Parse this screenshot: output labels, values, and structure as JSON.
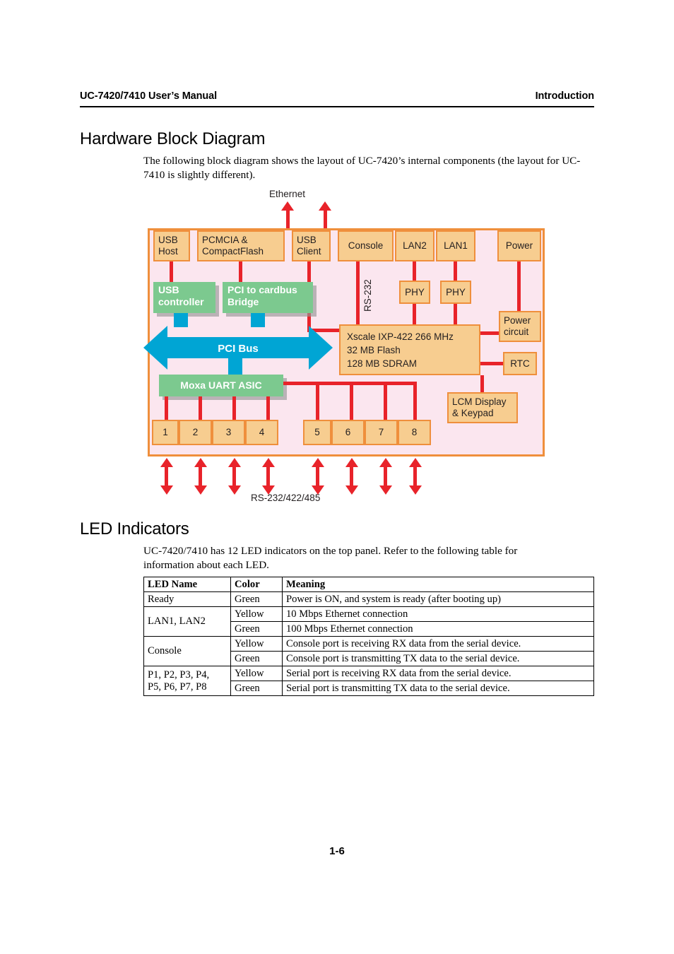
{
  "header": {
    "left": "UC-7420/7410 User’s Manual",
    "right": "Introduction"
  },
  "footer": {
    "page_number": "1-6"
  },
  "sections": {
    "hardware": {
      "heading": "Hardware Block Diagram",
      "paragraph": "The following block diagram shows the layout of UC-7420’s internal components (the layout for UC-7410 is slightly different)."
    },
    "led": {
      "heading": "LED Indicators",
      "paragraph": "UC-7420/7410 has 12 LED indicators on the top panel. Refer to the following table for information about each LED."
    }
  },
  "diagram": {
    "external_labels": {
      "ethernet": "Ethernet",
      "serial": "RS-232/422/485",
      "console_bus": "RS-232"
    },
    "interface_blocks": [
      {
        "id": "usb-host",
        "label": "USB\nHost",
        "line1": "USB",
        "line2": "Host"
      },
      {
        "id": "pcmcia",
        "label": "PCMCIA & CompactFlash",
        "line1": "PCMCIA &",
        "line2": "CompactFlash"
      },
      {
        "id": "usb-client",
        "label": "USB Client",
        "line1": "USB",
        "line2": "Client"
      },
      {
        "id": "console",
        "label": "Console"
      },
      {
        "id": "lan2",
        "label": "LAN2"
      },
      {
        "id": "lan1",
        "label": "LAN1"
      },
      {
        "id": "power",
        "label": "Power"
      }
    ],
    "controller_blocks": [
      {
        "id": "usb-controller",
        "line1": "USB",
        "line2": "controller"
      },
      {
        "id": "pci-cardbus",
        "line1": "PCI to cardbus",
        "line2": "Bridge"
      },
      {
        "id": "moxa-uart",
        "label": "Moxa UART ASIC"
      }
    ],
    "phy_blocks": [
      {
        "id": "phy-lan2",
        "label": "PHY"
      },
      {
        "id": "phy-lan1",
        "label": "PHY"
      }
    ],
    "bus": {
      "label": "PCI Bus"
    },
    "cpu": {
      "line1": "Xscale IXP-422 266 MHz",
      "line2": "32 MB Flash",
      "line3": "128 MB SDRAM"
    },
    "support_blocks": [
      {
        "id": "power-circuit",
        "line1": "Power",
        "line2": "circuit"
      },
      {
        "id": "rtc",
        "label": "RTC"
      },
      {
        "id": "lcm",
        "line1": "LCM Display",
        "line2": "& Keypad"
      }
    ],
    "serial_ports": [
      "1",
      "2",
      "3",
      "4",
      "5",
      "6",
      "7",
      "8"
    ],
    "colors": {
      "panel_background": "#fbe6ef",
      "panel_border": "#ef8f3c",
      "block_fill": "#f7cd90",
      "block_border": "#ef8f3c",
      "controller_fill": "#7cc98f",
      "bus_fill": "#00a5d4",
      "wire": "#e8232a"
    }
  },
  "led_table": {
    "columns": [
      "LED Name",
      "Color",
      "Meaning"
    ],
    "rows": [
      {
        "name": "Ready",
        "name_rowspan": 1,
        "color": "Green",
        "meaning": "Power is ON, and system is ready (after booting up)"
      },
      {
        "name": "LAN1, LAN2",
        "name_rowspan": 2,
        "color": "Yellow",
        "meaning": "10 Mbps Ethernet connection"
      },
      {
        "name": null,
        "color": "Green",
        "meaning": "100 Mbps Ethernet connection"
      },
      {
        "name": "Console",
        "name_rowspan": 2,
        "color": "Yellow",
        "meaning": "Console port is receiving RX data from the serial device."
      },
      {
        "name": null,
        "color": "Green",
        "meaning": "Console port is transmitting TX data to the serial device."
      },
      {
        "name": "P1, P2, P3, P4,",
        "name_line2": "P5, P6, P7, P8",
        "name_rowspan": 2,
        "color": "Yellow",
        "meaning": "Serial port is receiving RX data from the serial device."
      },
      {
        "name": null,
        "color": "Green",
        "meaning": "Serial port is transmitting TX data to the serial device."
      }
    ]
  }
}
